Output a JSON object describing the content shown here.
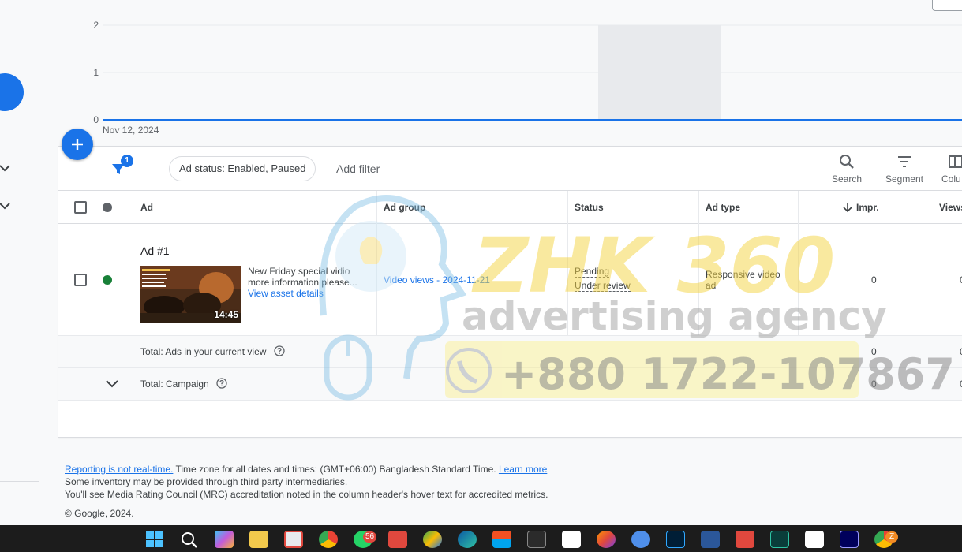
{
  "chart": {
    "y_ticks": [
      "2",
      "1",
      "0"
    ],
    "x_start_label": "Nov 12, 2024"
  },
  "toolbar": {
    "filter_count": "1",
    "status_chip": "Ad status: Enabled, Paused",
    "add_filter": "Add filter",
    "search_label": "Search",
    "segment_label": "Segment",
    "columns_label": "Colu"
  },
  "table": {
    "headers": {
      "ad": "Ad",
      "ad_group": "Ad group",
      "status": "Status",
      "ad_type": "Ad type",
      "impr": "Impr.",
      "views": "Views"
    },
    "row": {
      "title": "Ad #1",
      "description_line1": "New Friday special vidio",
      "description_line2": "more information please...",
      "view_asset": "View asset details",
      "duration": "14:45",
      "ad_group": "Video views - 2024-11-21",
      "status_line1": "Pending",
      "status_line2": "Under review",
      "ad_type_line1": "Responsive video",
      "ad_type_line2": "ad",
      "impr": "0",
      "views": "0"
    },
    "total_view": {
      "label": "Total: Ads in your current view",
      "impr": "0",
      "views": "0"
    },
    "total_campaign": {
      "label": "Total: Campaign",
      "impr": "0",
      "views": "0"
    }
  },
  "watermark": {
    "brand": "ZHK 360",
    "tagline": "advertising agency",
    "phone": "+880 1722-107867"
  },
  "footer": {
    "realtime_link": "Reporting is not real-time.",
    "timezone_text": " Time zone for all dates and times: (GMT+06:00) Bangladesh Standard Time. ",
    "learn_more": "Learn more",
    "line2": "Some inventory may be provided through third party intermediaries.",
    "line3": "You'll see Media Rating Council (MRC) accreditation noted in the column header's hover text for accredited metrics.",
    "copyright": "© Google, 2024."
  },
  "taskbar": {
    "whatsapp_badge": "56",
    "chrome_badge": "Z"
  },
  "colors": {
    "accent": "#1a73e8",
    "status_dot": "#188038",
    "watermark_yellow": "#f5d442",
    "watermark_gray": "#c4c4c4",
    "taskbar": "#1c1c1c"
  }
}
